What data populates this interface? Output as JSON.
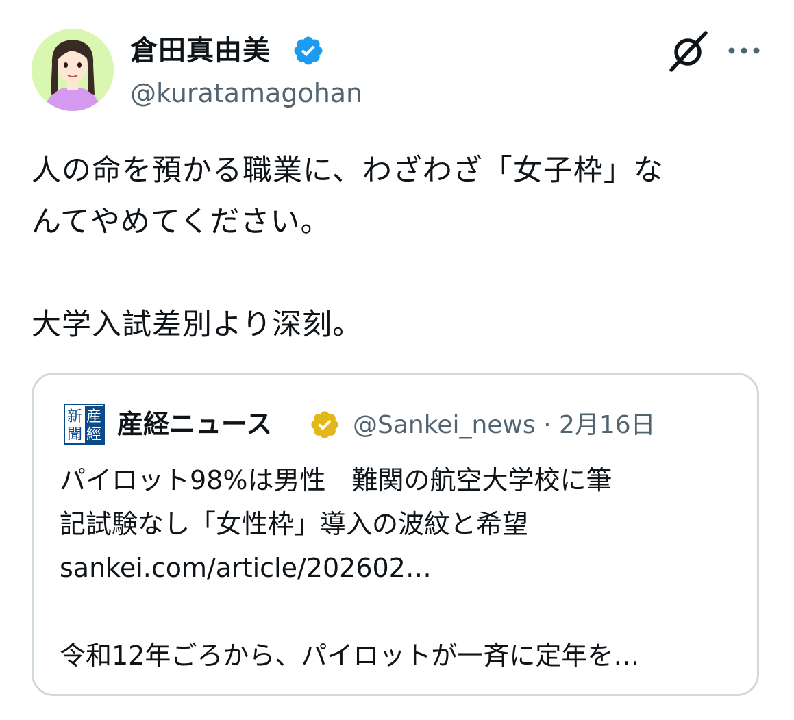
{
  "author": {
    "display_name": "倉田真由美",
    "handle": "@kuratamagohan",
    "verified": "blue"
  },
  "tweet": {
    "lines": [
      "人の命を預かる職業に、わざわざ「女子枠」な",
      "んてやめてください。",
      "大学入試差別より深刻。"
    ]
  },
  "quote": {
    "logo_chars": [
      "産",
      "經",
      "新",
      "聞"
    ],
    "name": "産経ニュース",
    "verified": "gold",
    "handle": "@Sankei_news",
    "separator": "·",
    "date": "2月16日",
    "lines": [
      "パイロット98%は男性　難関の航空大学校に筆",
      "記試験なし「女性枠」導入の波紋と希望",
      "sankei.com/article/202602…",
      "令和12年ごろから、パイロットが一斉に定年を…"
    ]
  },
  "icons": {
    "grok": "grok-icon",
    "more": "more-dots-icon",
    "verified_blue": "verified-badge-icon",
    "verified_gold": "gold-verified-badge-icon"
  },
  "colors": {
    "text": "#0f1419",
    "secondary": "#536471",
    "verified_blue": "#1d9bf0",
    "verified_gold": "#e2b719",
    "card_border": "#cfd9de",
    "sankei_logo": "#0c4a8a"
  }
}
